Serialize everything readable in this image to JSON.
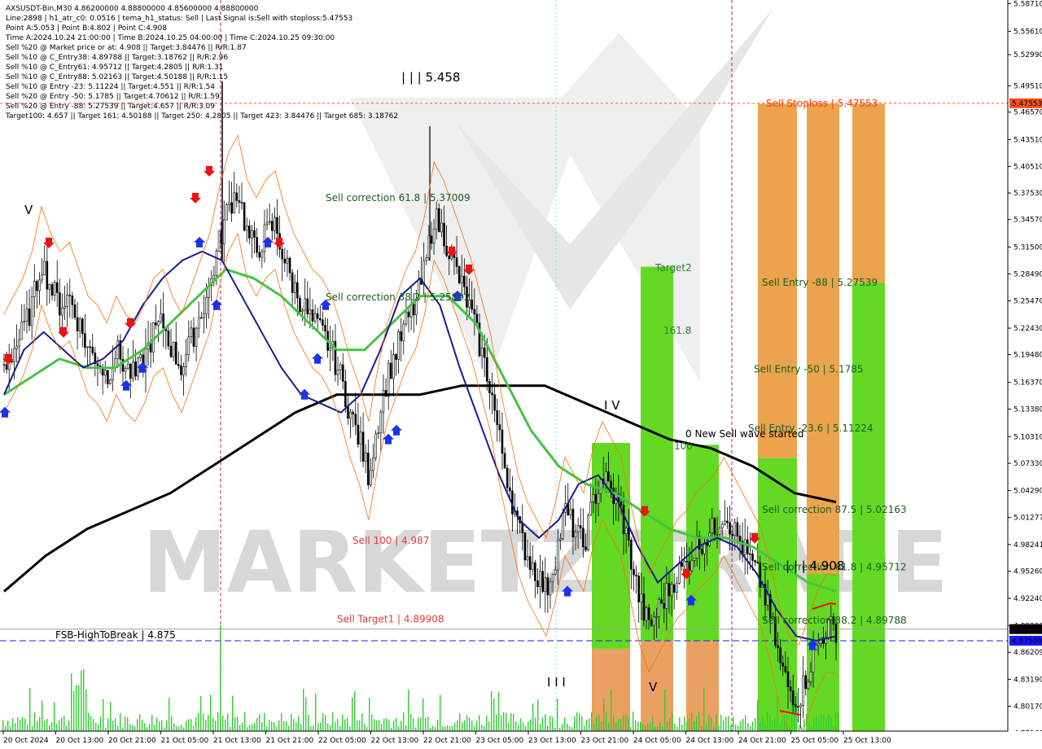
{
  "info_panel": [
    "AXSUSDT-Bin,M30  4.86200000 4.88800000 4.85600000 4.88800000",
    "Line:2898 | h1_atr_c0: 0.0516 | tema_h1_status: Sell | Last Signal is:Sell with stoploss:5.47553",
    "Point A:5.053 | Point B:4.802 | Point C:4.908",
    "Time A:2024.10.24 21:00:00 | Time B:2024.10.25 04:00:00 | Time C:2024.10.25 09:30:00",
    "Sell %20 @ Market price or at: 4.908 || Target:3.84476 || R/R:1.87",
    "Sell %10 @ C_Entry38: 4.89788 || Target:3.18762 || R/R:2.96",
    "Sell %10 @ C_Entry61: 4.95712 || Target:4.2805 || R/R:1.31",
    "Sell %10 @ C_Entry88: 5.02163 || Target:4.50188 || R/R:1.15",
    "Sell %10 @ Entry -23: 5.11224 || Target:4.551 || R/R:1.54",
    "Sell %20 @ Entry -50: 5.1785 || Target:4.70612 || R/R:1.59",
    "Sell %20 @ Entry -88: 5.27539 || Target:4.657 || R/R:3.09",
    "Target100: 4.657 || Target 161: 4.50188 || Target 250: 4.2805 || Target 423: 3.84476 || Target 685: 3.18762"
  ],
  "chart_data": {
    "type": "candlestick",
    "symbol": "AXSUSDT-Bin",
    "timeframe": "M30",
    "ylim": [
      4.774,
      5.591
    ],
    "y_ticks": [
      "5.58710",
      "5.55610",
      "5.52990",
      "5.49510",
      "5.46570",
      "5.43510",
      "5.40510",
      "5.37530",
      "5.34570",
      "5.31500",
      "5.28490",
      "5.25470",
      "5.22430",
      "5.19480",
      "5.16370",
      "5.13380",
      "5.10310",
      "5.07330",
      "5.04290",
      "5.01277",
      "4.98241",
      "4.95260",
      "4.92240",
      "4.89200",
      "4.86209",
      "4.83190",
      "4.80170",
      "4.77160"
    ],
    "x_ticks": [
      "20 Oct 2024",
      "20 Oct 13:00",
      "20 Oct 21:00",
      "21 Oct 05:00",
      "21 Oct 13:00",
      "21 Oct 21:00",
      "22 Oct 05:00",
      "22 Oct 13:00",
      "22 Oct 21:00",
      "23 Oct 05:00",
      "23 Oct 13:00",
      "23 Oct 21:00",
      "24 Oct 05:00",
      "24 Oct 13:00",
      "24 Oct 21:00",
      "25 Oct 05:00",
      "25 Oct 13:00"
    ],
    "price_tags": [
      {
        "value": 5.47553,
        "label": "5.47553",
        "color": "#f4511e"
      },
      {
        "value": 4.888,
        "label": "4.88800",
        "color": "#000000"
      },
      {
        "value": 4.875,
        "label": "4.87500",
        "color": "#1a1aff"
      }
    ],
    "close_path": [
      5.18,
      5.2,
      5.22,
      5.25,
      5.3,
      5.27,
      5.25,
      5.26,
      5.23,
      5.2,
      5.19,
      5.17,
      5.2,
      5.18,
      5.17,
      5.19,
      5.22,
      5.23,
      5.2,
      5.18,
      5.21,
      5.24,
      5.27,
      5.32,
      5.36,
      5.38,
      5.33,
      5.31,
      5.33,
      5.34,
      5.3,
      5.27,
      5.25,
      5.23,
      5.22,
      5.2,
      5.17,
      5.13,
      5.1,
      5.06,
      5.12,
      5.17,
      5.2,
      5.23,
      5.25,
      5.29,
      5.35,
      5.33,
      5.3,
      5.27,
      5.24,
      5.2,
      5.16,
      5.1,
      5.05,
      5.0,
      4.97,
      4.95,
      4.93,
      4.97,
      5.02,
      5.0,
      4.98,
      5.03,
      5.06,
      5.04,
      5.02,
      4.97,
      4.92,
      4.89,
      4.91,
      4.93,
      4.95,
      4.96,
      4.98,
      4.99,
      5.0,
      5.02,
      5.0,
      4.98,
      4.96,
      4.94,
      4.9,
      4.85,
      4.82,
      4.81,
      4.84,
      4.87,
      4.89,
      4.888
    ],
    "ema_blue": [
      5.15,
      5.2,
      5.22,
      5.2,
      5.18,
      5.19,
      5.21,
      5.25,
      5.28,
      5.3,
      5.31,
      5.3,
      5.26,
      5.22,
      5.18,
      5.15,
      5.14,
      5.13,
      5.15,
      5.2,
      5.26,
      5.28,
      5.25,
      5.18,
      5.12,
      5.06,
      5.01,
      4.99,
      5.01,
      5.05,
      5.06,
      5.03,
      4.98,
      4.94,
      4.96,
      4.98,
      4.99,
      4.98,
      4.95,
      4.91,
      4.88,
      4.875,
      4.88
    ],
    "ema_green": [
      5.15,
      5.17,
      5.19,
      5.18,
      5.18,
      5.2,
      5.23,
      5.26,
      5.29,
      5.28,
      5.26,
      5.23,
      5.2,
      5.2,
      5.23,
      5.26,
      5.26,
      5.23,
      5.17,
      5.11,
      5.07,
      5.05,
      5.04,
      5.02,
      5.0,
      4.99,
      4.99,
      4.98,
      4.96,
      4.94,
      4.93
    ],
    "ema_black": [
      4.93,
      4.97,
      5.0,
      5.02,
      5.04,
      5.07,
      5.1,
      5.13,
      5.15,
      5.15,
      5.15,
      5.16,
      5.16,
      5.16,
      5.14,
      5.12,
      5.1,
      5.09,
      5.07,
      5.04,
      5.03
    ],
    "levels": [
      {
        "label": "Sell Stoploss | 5.47553",
        "value": 5.47553,
        "color": "#ff3d00"
      },
      {
        "label": "Sell Entry -88 | 5.27539",
        "value": 5.27539,
        "color": "#2e7d32"
      },
      {
        "label": "Sell Entry -50 | 5.1785",
        "value": 5.1785,
        "color": "#2e7d32"
      },
      {
        "label": "Sell Entry -23.6 | 5.11224",
        "value": 5.11224,
        "color": "#2e7d32"
      },
      {
        "label": "Sell correction 87.5 | 5.02163",
        "value": 5.02163,
        "color": "#2e7d32"
      },
      {
        "label": "Sell correction 61.8 | 4.95712",
        "value": 4.95712,
        "color": "#2e7d32"
      },
      {
        "label": "Sell correction 38.2 | 4.89788",
        "value": 4.89788,
        "color": "#2e7d32"
      },
      {
        "label": "Sell correction 61.8 | 5.37009",
        "value": 5.37009,
        "color": "#2e7d32"
      },
      {
        "label": "Sell correction 38.2 | 5.25892",
        "value": 5.25892,
        "color": "#2e7d32"
      },
      {
        "label": "Sell 100 | 4.987",
        "value": 4.987,
        "color": "#e53935"
      },
      {
        "label": "Sell Target1 | 4.89908",
        "value": 4.89908,
        "color": "#e53935"
      },
      {
        "label": "FSB-HighToBreak | 4.875",
        "value": 4.875,
        "color": "#000000"
      }
    ],
    "annotations": [
      "Target2",
      "161.8",
      "100",
      "0 New Sell wave started",
      "| | | 5.458",
      "| | | 4.908",
      "I V",
      "I I I",
      "V"
    ],
    "watermark": "MARKETZITRADE"
  }
}
